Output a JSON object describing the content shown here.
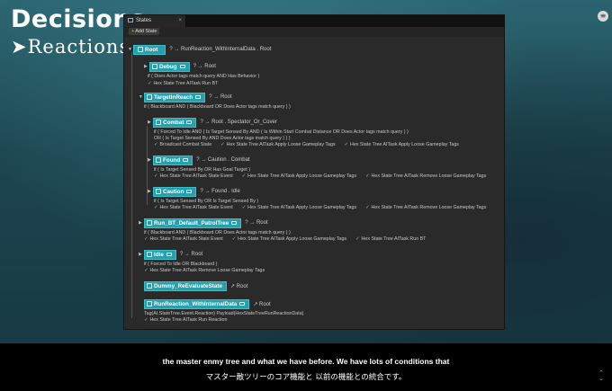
{
  "slide": {
    "title": "Decisions",
    "subtitle": "➤Reactions"
  },
  "editor": {
    "tab_label": "States",
    "tab_close": "×",
    "add_state_label": "Add State"
  },
  "icons": {
    "corner_menu": "menu-icon",
    "check": "checkmark-icon",
    "state": "state-node-icon",
    "comment": "comment-bubble-icon"
  },
  "colors": {
    "node_fill": "#27a0ad",
    "check_green": "#7ad37a",
    "caption_background": "#000000"
  },
  "tree": {
    "root": {
      "name": "Root",
      "transition": "? → RunReaction_WithInternalData . Root"
    },
    "debug": {
      "name": "Debug",
      "transition": "? → Root",
      "condition": "if ( Does Actor tags match query  AND  Has Behavior )",
      "tasks": [
        "Hex State Tree AITask Run BT"
      ]
    },
    "target_in_reach": {
      "name": "TargetInReach",
      "transition": "? → Root",
      "condition": "if ( Blackboard  AND  ( Blackboard  OR  Does Actor tags match query ) )"
    },
    "combat": {
      "name": "Combat",
      "transition": "? → Root . Spectator_Or_Cover",
      "condition_1": "if ( Forced To Idle  AND  ( Is Target Sensed By  AND  ( Is Within Start Combat Distance  OR  Does Actor tags match query ) )",
      "condition_2": "OR  ( Is Target Sensed By  AND  Does Actor tags match query ) ) )",
      "tasks": [
        "Broadcast Combat State",
        "Hex State Tree AITask Apply Loose Gameplay Tags",
        "Hex State Tree AITask Apply Loose Gameplay Tags"
      ]
    },
    "found": {
      "name": "Found",
      "transition": "? → Caution . Combat",
      "condition": "if ( Is Target Sensed By  OR  Has Goal Target )",
      "tasks": [
        "Hex State Tree AITask State Event",
        "Hex State Tree AITask Apply Loose Gameplay Tags",
        "Hex State Tree AITask Remove Loose Gameplay Tags"
      ]
    },
    "caution": {
      "name": "Caution",
      "transition": "? → Found . Idle",
      "condition": "if ( Is Target Sensed By  OR  Is Target Sensed By )",
      "tasks": [
        "Hex State Tree AITask State Event",
        "Hex State Tree AITask Apply Loose Gameplay Tags",
        "Hex State Tree AITask Remove Loose Gameplay Tags"
      ]
    },
    "run_bt": {
      "name": "Run_BT_Default_PatrolTree",
      "transition": "? → Root",
      "condition": "if ( Blackboard  AND  ( Blackboard  OR  Does Actor tags match query ) )",
      "tasks": [
        "Hex State Tree AITask State Event",
        "Hex State Tree AITask Apply Loose Gameplay Tags",
        "Hex State Tree AITask Run BT"
      ]
    },
    "idle": {
      "name": "Idle",
      "transition": "? → Root",
      "condition": "if ( Forced To Idle  OR  Blackboard )",
      "tasks": [
        "Hex State Tree AITask Remove Loose Gameplay Tags"
      ]
    },
    "dummy": {
      "name": "Dummy_ReEvaluateState",
      "transition": "↗ Root"
    },
    "run_reaction": {
      "name": "RunReaction_WithInternalData",
      "transition": "↗ Root",
      "event": "Tag(AI.StateTree.Event.Reaction)  Payload(HexStateTreeRunReactionData)",
      "tasks": [
        "Hex State Tree AITask Run Reaction"
      ]
    }
  },
  "captions": {
    "english": "the master enmy tree and what we have before. We have lots of conditions that",
    "japanese": "マスター敵ツリーのコア機能と 以前の機能との統合です。"
  }
}
